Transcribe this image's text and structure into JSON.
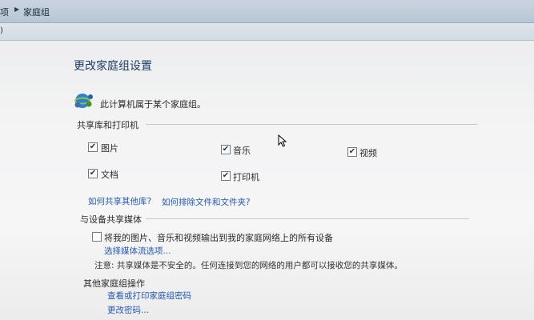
{
  "breadcrumb": {
    "items": [
      "项",
      "家庭组"
    ]
  },
  "page": {
    "title": "更改家庭组设置",
    "homegroup_text": "此计算机属于某个家庭组。"
  },
  "libraries": {
    "heading": "共享库和打印机",
    "items": [
      {
        "label": "图片",
        "checked": true
      },
      {
        "label": "音乐",
        "checked": true
      },
      {
        "label": "视频",
        "checked": true
      },
      {
        "label": "文档",
        "checked": true
      },
      {
        "label": "打印机",
        "checked": true
      }
    ],
    "link_other_libraries": "如何共享其他库?",
    "link_exclude": "如何排除文件和文件夹?"
  },
  "media": {
    "heading": "与设备共享媒体",
    "stream_label": "将我的图片、音乐和视频输出到我的家庭网络上的所有设备",
    "stream_checked": false,
    "stream_options_link": "选择媒体流选项...",
    "note": "注意: 共享媒体是不安全的。任何连接到您的网络的用户都可以接收您的共享媒体。"
  },
  "other": {
    "heading": "其他家庭组操作",
    "view_password_link": "查看或打印家庭组密码",
    "change_password_link": "更改密码..."
  }
}
